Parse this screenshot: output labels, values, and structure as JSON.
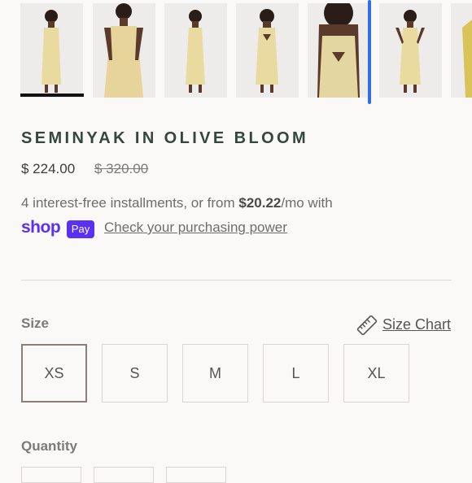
{
  "gallery": {
    "thumbnails": [
      {
        "alt": "dress front view"
      },
      {
        "alt": "dress front close view"
      },
      {
        "alt": "dress side view"
      },
      {
        "alt": "dress back view"
      },
      {
        "alt": "dress back close view"
      },
      {
        "alt": "dress front pose"
      },
      {
        "alt": "dress detail"
      }
    ],
    "active_index": 0,
    "colors": {
      "dress": "#e9dba0",
      "skin": "#5a3a2a",
      "hair": "#2a1d17"
    }
  },
  "product": {
    "title": "SEMINYAK IN OLIVE BLOOM",
    "price": "$ 224.00",
    "compare_price": "$ 320.00"
  },
  "installments": {
    "prefix": "4 interest-free installments, or from ",
    "amount": "$20.22",
    "suffix": "/mo with",
    "shop_logo": "shop",
    "pay_badge": "Pay",
    "link": "Check your purchasing power"
  },
  "size": {
    "label": "Size",
    "chart_link": "Size Chart",
    "chart_icon": "ruler-icon",
    "options": [
      "XS",
      "S",
      "M",
      "L",
      "XL"
    ],
    "selected": "XS"
  },
  "quantity": {
    "label": "Quantity"
  },
  "colors": {
    "accent": "#5a31f4",
    "title": "#33463f",
    "scroll_indicator": "#2f6ee8"
  }
}
